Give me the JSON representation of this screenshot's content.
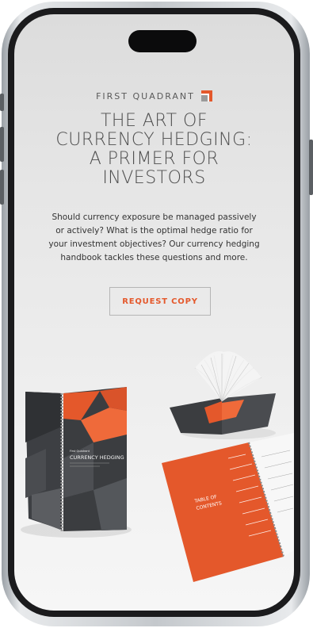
{
  "brand": {
    "name": "FIRST QUADRANT",
    "accent_color": "#e4582b"
  },
  "hero": {
    "headline_lines": [
      "THE ART OF",
      "CURRENCY HEDGING:",
      "A PRIMER FOR",
      "INVESTORS"
    ],
    "body_lines": [
      "Should currency exposure be managed passively",
      "or actively? What is the optimal hedge ratio for",
      "your investment objectives? Our currency hedging",
      "handbook tackles these questions and more."
    ],
    "cta_label": "REQUEST COPY"
  },
  "books": {
    "cover_title": "CURRENCY HEDGING",
    "toc_title_lines": [
      "TABLE OF",
      "CONTENTS"
    ]
  },
  "colors": {
    "orange": "#e4582b",
    "dark_gray": "#3b3d40",
    "text_gray": "#4d4d4d"
  }
}
